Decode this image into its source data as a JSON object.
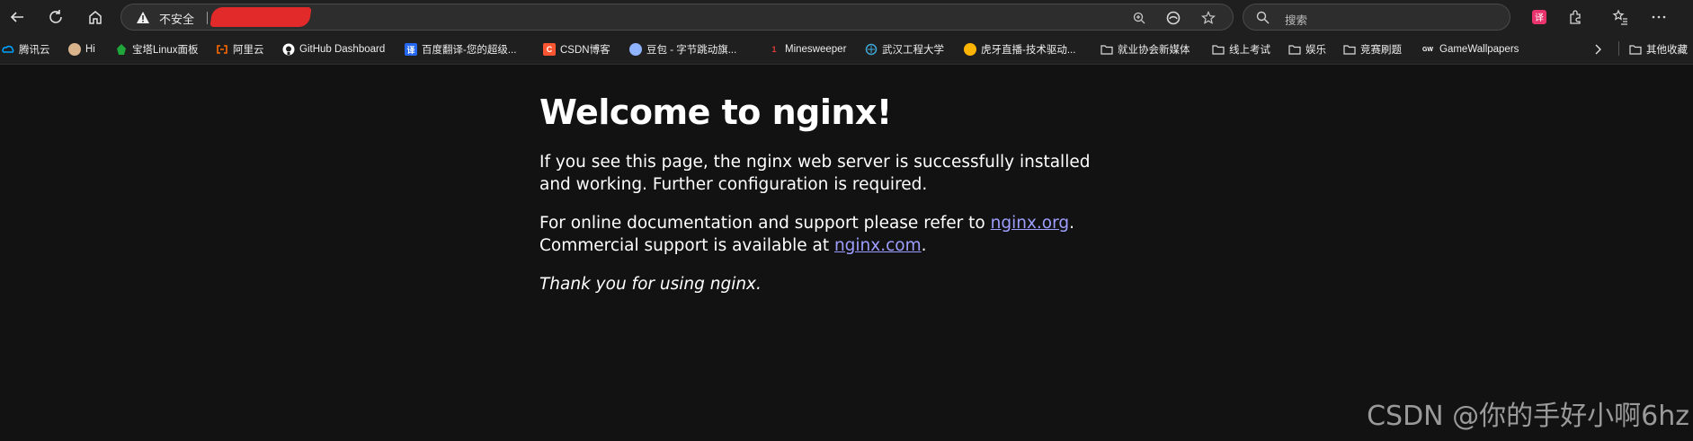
{
  "toolbar": {
    "security_label": "不安全",
    "search_placeholder": "搜索"
  },
  "bookmarks": [
    {
      "label": "腾讯云",
      "icon": "tencent-cloud-icon",
      "color": "#00a3ff"
    },
    {
      "label": "Hi",
      "icon": "hi-avatar-icon",
      "color": "#d9b38c"
    },
    {
      "label": "宝塔Linux面板",
      "icon": "baota-icon",
      "color": "#20a53a"
    },
    {
      "label": "阿里云",
      "icon": "aliyun-icon",
      "color": "#ff6a00"
    },
    {
      "label": "GitHub Dashboard",
      "icon": "github-icon",
      "color": "#ffffff"
    },
    {
      "label": "百度翻译-您的超级...",
      "icon": "baidu-translate-icon",
      "color": "#2468f2"
    },
    {
      "label": "CSDN博客",
      "icon": "csdn-icon",
      "color": "#fc5531"
    },
    {
      "label": "豆包 - 字节跳动旗...",
      "icon": "doubao-icon",
      "color": "#8fb3ff"
    },
    {
      "label": "Minesweeper",
      "icon": "minesweeper-icon",
      "color": "#e03a3a"
    },
    {
      "label": "武汉工程大学",
      "icon": "wit-icon",
      "color": "#3fa7d6"
    },
    {
      "label": "虎牙直播-技术驱动...",
      "icon": "huya-icon",
      "color": "#ffb400"
    },
    {
      "label": "就业协会新媒体",
      "icon": "folder-icon",
      "color": "#dcdcdc"
    },
    {
      "label": "线上考试",
      "icon": "folder-icon",
      "color": "#dcdcdc"
    },
    {
      "label": "娱乐",
      "icon": "folder-icon",
      "color": "#dcdcdc"
    },
    {
      "label": "竞赛刷题",
      "icon": "folder-icon",
      "color": "#dcdcdc"
    },
    {
      "label": "GameWallpapers",
      "icon": "gamewallpapers-icon",
      "color": "#ffffff"
    },
    {
      "label": "其他收藏",
      "icon": "folder-icon",
      "color": "#dcdcdc"
    }
  ],
  "page": {
    "heading": "Welcome to nginx!",
    "para1": "If you see this page, the nginx web server is successfully installed and working. Further configuration is required.",
    "para2_prefix": "For online documentation and support please refer to ",
    "link_org": "nginx.org",
    "para2_mid": ".",
    "para2_line2_prefix": "Commercial support is available at ",
    "link_com": "nginx.com",
    "para2_suffix": ".",
    "thanks": "Thank you for using nginx."
  },
  "watermark": "CSDN @你的手好小啊6hz"
}
